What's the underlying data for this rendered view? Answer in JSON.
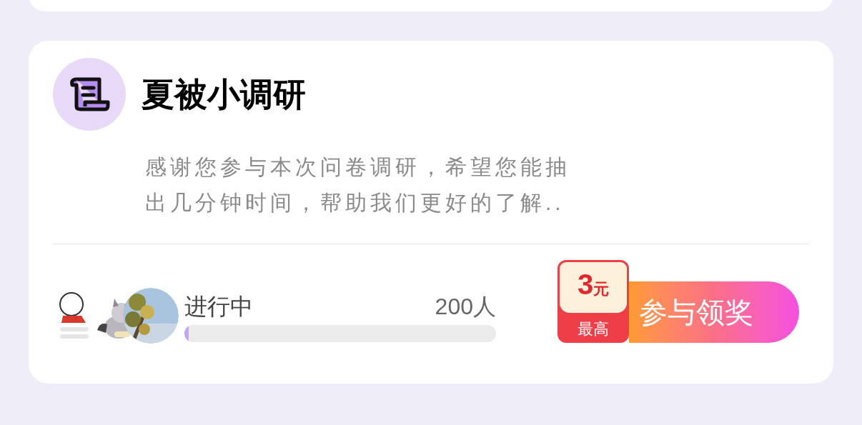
{
  "survey_card": {
    "title": "夏被小调研",
    "description": "感谢您参与本次问卷调研，希望您能抽出几分钟时间，帮助我们更好的了解..",
    "participants": {
      "status": "进行中",
      "count": "200人",
      "progress": {
        "level": 0.01
      }
    },
    "reward": {
      "amount": "3",
      "unit": "元",
      "caption": "最高"
    },
    "action_button": {
      "label": "参与领奖"
    }
  }
}
